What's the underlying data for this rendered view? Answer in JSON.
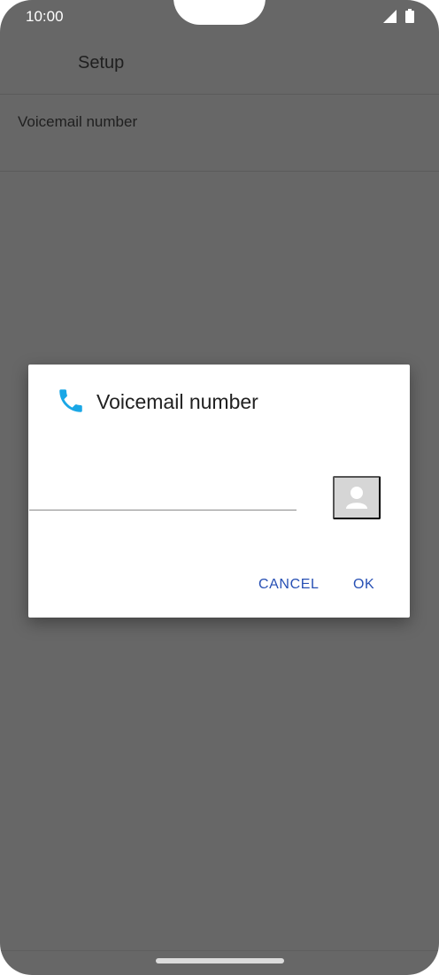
{
  "status_bar": {
    "time": "10:00",
    "icons": [
      "signal-icon",
      "battery-icon"
    ]
  },
  "app_bar": {
    "title": "Setup"
  },
  "settings": {
    "voicemail_label": "Voicemail number"
  },
  "dialog": {
    "icon": "phone-icon",
    "title": "Voicemail number",
    "input_value": "",
    "contact_icon": "contact-icon",
    "cancel_label": "CANCEL",
    "ok_label": "OK"
  },
  "colors": {
    "scrim": "#676767",
    "accent_icon": "#1aa7e6",
    "button_text": "#2750b4"
  }
}
